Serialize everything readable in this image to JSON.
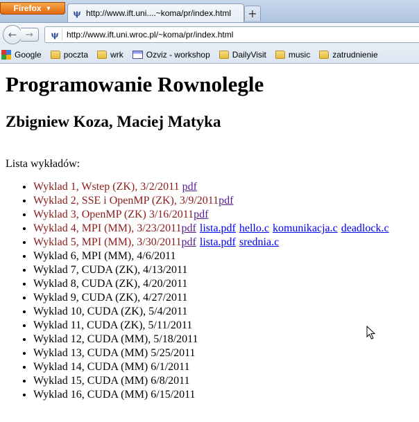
{
  "browser": {
    "menu_button": "Firefox",
    "tab_title": "http://www.ift.uni....~koma/pr/index.html",
    "url": "http://www.ift.uni.wroc.pl/~koma/pr/index.html",
    "favicon_glyph": "ψ",
    "back_glyph": "←",
    "forward_glyph": "→",
    "newtab_glyph": "+",
    "close_glyph": "×"
  },
  "bookmarks": [
    {
      "label": "Google",
      "icon": "google-icon"
    },
    {
      "label": "poczta",
      "icon": "folder-icon"
    },
    {
      "label": "wrk",
      "icon": "folder-icon"
    },
    {
      "label": "Ozviz - workshop",
      "icon": "ozviz-icon"
    },
    {
      "label": "DailyVisit",
      "icon": "folder-icon"
    },
    {
      "label": "music",
      "icon": "folder-icon"
    },
    {
      "label": "zatrudnienie",
      "icon": "folder-icon"
    }
  ],
  "page": {
    "title": "Programowanie Rownolegle",
    "authors": "Zbigniew Koza, Maciej Matyka",
    "lista_label": "Lista wykładów:",
    "lectures": [
      {
        "text": "Wyklad 1, Wstep (ZK), 3/2/2011 ",
        "done": true,
        "links": [
          "pdf"
        ]
      },
      {
        "text": "Wyklad 2, SSE i OpenMP (ZK), 3/9/2011",
        "done": true,
        "links": [
          "pdf"
        ]
      },
      {
        "text": "Wyklad 3, OpenMP (ZK) 3/16/2011",
        "done": true,
        "links": [
          "pdf"
        ]
      },
      {
        "text": "Wyklad 4, MPI (MM), 3/23/2011",
        "done": true,
        "links": [
          "pdf",
          "lista.pdf",
          "hello.c",
          "komunikacja.c",
          "deadlock.c"
        ]
      },
      {
        "text": "Wyklad 5, MPI (MM), 3/30/2011",
        "done": true,
        "links": [
          "pdf",
          "lista.pdf",
          "srednia.c"
        ]
      },
      {
        "text": "Wyklad 6, MPI (MM), 4/6/2011",
        "done": false,
        "links": []
      },
      {
        "text": "Wyklad 7, CUDA (ZK), 4/13/2011",
        "done": false,
        "links": []
      },
      {
        "text": "Wyklad 8, CUDA (ZK), 4/20/2011",
        "done": false,
        "links": []
      },
      {
        "text": "Wyklad 9, CUDA (ZK), 4/27/2011",
        "done": false,
        "links": []
      },
      {
        "text": "Wyklad 10, CUDA (ZK), 5/4/2011",
        "done": false,
        "links": []
      },
      {
        "text": "Wyklad 11, CUDA (ZK), 5/11/2011",
        "done": false,
        "links": []
      },
      {
        "text": "Wyklad 12, CUDA (MM), 5/18/2011",
        "done": false,
        "links": []
      },
      {
        "text": "Wyklad 13, CUDA (MM) 5/25/2011",
        "done": false,
        "links": []
      },
      {
        "text": "Wyklad 14, CUDA (MM) 6/1/2011",
        "done": false,
        "links": []
      },
      {
        "text": "Wyklad 15, CUDA (MM) 6/8/2011",
        "done": false,
        "links": []
      },
      {
        "text": "Wyklad 16, CUDA (MM) 6/15/2011",
        "done": false,
        "links": []
      }
    ]
  },
  "colors": {
    "done_text": "#8b1a1a",
    "link": "#0000ee",
    "visited_link": "#551a8b",
    "firefox_button": "#e0690e"
  }
}
